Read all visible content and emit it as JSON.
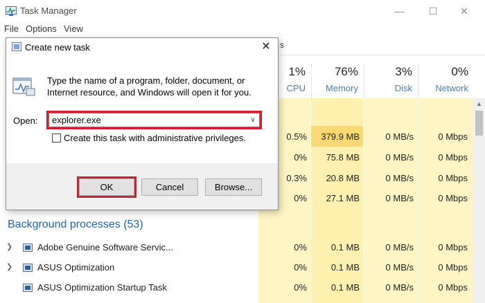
{
  "window": {
    "title": "Task Manager",
    "menu": [
      "File",
      "Options",
      "View"
    ],
    "controls": {
      "minimize": "—",
      "maximize": "☐",
      "close": "✕"
    }
  },
  "tab_fragment": "s",
  "columns": [
    {
      "pct": "1%",
      "label": "CPU"
    },
    {
      "pct": "76%",
      "label": "Memory"
    },
    {
      "pct": "3%",
      "label": "Disk"
    },
    {
      "pct": "0%",
      "label": "Network"
    }
  ],
  "app_rows": [
    {
      "cpu": "0.5%",
      "memory": "379.9 MB",
      "disk": "0 MB/s",
      "network": "0 Mbps"
    },
    {
      "cpu": "0%",
      "memory": "75.8 MB",
      "disk": "0 MB/s",
      "network": "0 Mbps"
    },
    {
      "cpu": "0.3%",
      "memory": "20.8 MB",
      "disk": "0 MB/s",
      "network": "0 Mbps"
    },
    {
      "cpu": "0%",
      "memory": "27.1 MB",
      "disk": "0 MB/s",
      "network": "0 Mbps"
    }
  ],
  "background": {
    "title": "Background processes (53)",
    "rows": [
      {
        "name": "Adobe Genuine Software Servic...",
        "cpu": "0%",
        "memory": "0.1 MB",
        "disk": "0 MB/s",
        "network": "0 Mbps"
      },
      {
        "name": "ASUS Optimization",
        "cpu": "0%",
        "memory": "0.1 MB",
        "disk": "0 MB/s",
        "network": "0 Mbps"
      },
      {
        "name": "ASUS Optimization Startup Task",
        "cpu": "0%",
        "memory": "0.1 MB",
        "disk": "0 MB/s",
        "network": "0 Mbps"
      }
    ]
  },
  "colors": {
    "heat_light": "#fff4c4",
    "heat_mid": "#fff0b0",
    "heat_strong": "#fcd875",
    "highlight_red": "#d3202e",
    "section_blue": "#1f63b5"
  },
  "dialog": {
    "title": "Create new task",
    "close": "✕",
    "description": "Type the name of a program, folder, document, or Internet resource, and Windows will open it for you.",
    "open_label": "Open:",
    "open_value": "explorer.exe",
    "checkbox_label": "Create this task with administrative privileges.",
    "checkbox_checked": false,
    "buttons": {
      "ok": "OK",
      "cancel": "Cancel",
      "browse": "Browse..."
    }
  }
}
